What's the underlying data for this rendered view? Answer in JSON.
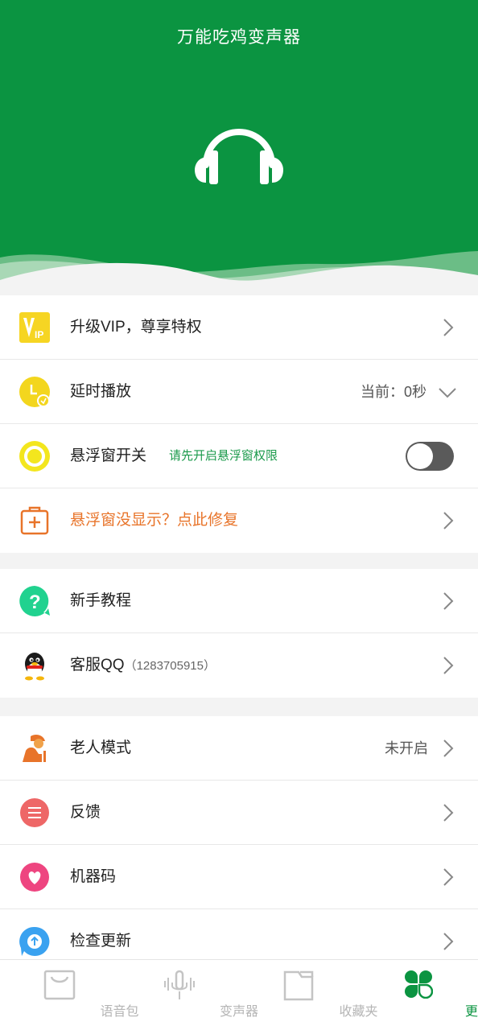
{
  "app": {
    "title": "万能吃鸡变声器"
  },
  "colors": {
    "brand": "#0b9441",
    "warning": "#e8742a",
    "hint": "#1b9a4b"
  },
  "menu": {
    "vip": {
      "label": "升级VIP，尊享特权",
      "icon": "vip-icon"
    },
    "delay": {
      "label": "延时播放",
      "value": "当前：0秒",
      "icon": "clock-icon"
    },
    "float_switch": {
      "label": "悬浮窗开关",
      "hint": "请先开启悬浮窗权限",
      "enabled": false,
      "icon": "float-circle-icon"
    },
    "fix": {
      "label": "悬浮窗没显示？点此修复",
      "icon": "medkit-icon"
    },
    "tutorial": {
      "label": "新手教程",
      "icon": "question-icon"
    },
    "service_qq": {
      "label": "客服QQ",
      "number": "（1283705915）",
      "icon": "qq-penguin-icon"
    },
    "elder_mode": {
      "label": "老人模式",
      "value": "未开启",
      "icon": "elder-icon"
    },
    "feedback": {
      "label": "反馈",
      "icon": "feedback-icon"
    },
    "machine_code": {
      "label": "机器码",
      "icon": "heart-icon"
    },
    "update": {
      "label": "检查更新",
      "icon": "update-icon"
    }
  },
  "tabs": [
    {
      "label": "语音包",
      "icon": "bag-icon",
      "active": false
    },
    {
      "label": "变声器",
      "icon": "microphone-icon",
      "active": false
    },
    {
      "label": "收藏夹",
      "icon": "folder-icon",
      "active": false
    },
    {
      "label": "更多",
      "icon": "clover-icon",
      "active": true
    }
  ]
}
